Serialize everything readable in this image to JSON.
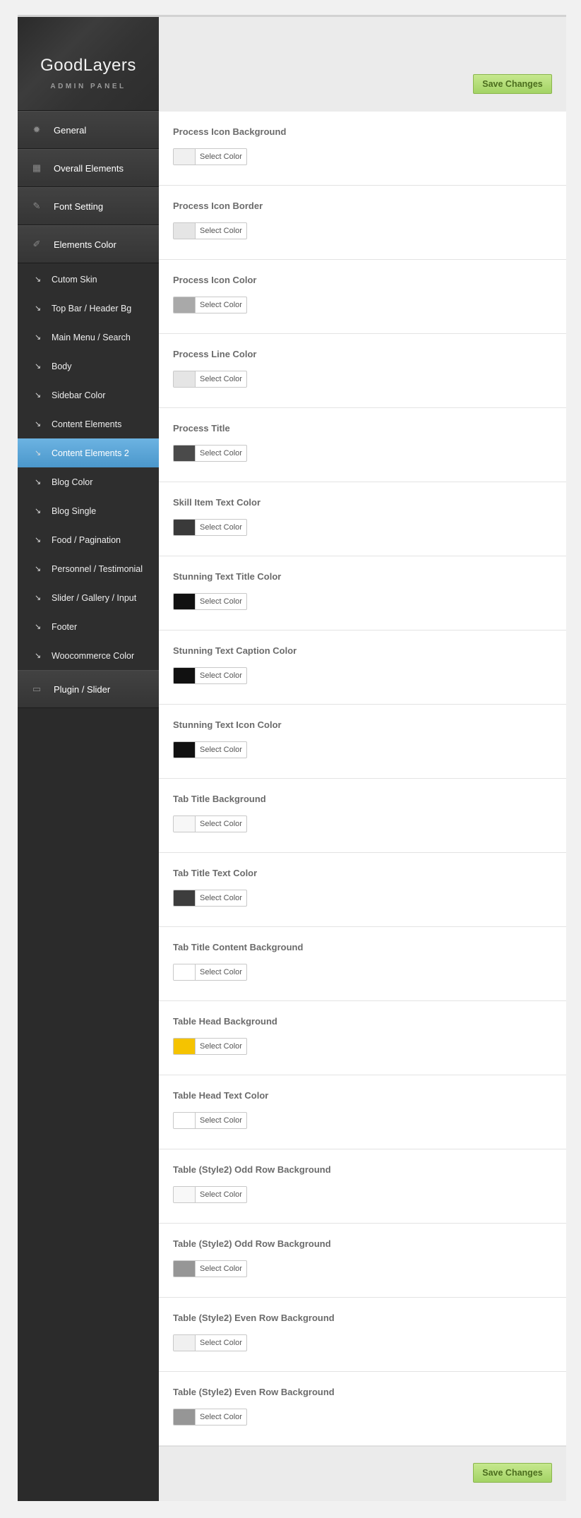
{
  "logo": {
    "title": "GoodLayers",
    "subtitle": "ADMIN PANEL"
  },
  "nav": {
    "top_items": [
      {
        "label": "General",
        "icon": "gear-icon"
      },
      {
        "label": "Overall Elements",
        "icon": "layout-icon"
      },
      {
        "label": "Font Setting",
        "icon": "pencil-icon"
      },
      {
        "label": "Elements Color",
        "icon": "brush-icon"
      }
    ],
    "sub_items": [
      {
        "label": "Cutom Skin"
      },
      {
        "label": "Top Bar / Header Bg"
      },
      {
        "label": "Main Menu / Search"
      },
      {
        "label": "Body"
      },
      {
        "label": "Sidebar Color"
      },
      {
        "label": "Content Elements"
      },
      {
        "label": "Content Elements 2",
        "active": true
      },
      {
        "label": "Blog Color"
      },
      {
        "label": "Blog Single"
      },
      {
        "label": "Food / Pagination"
      },
      {
        "label": "Personnel / Testimonial"
      },
      {
        "label": "Slider / Gallery / Input"
      },
      {
        "label": "Footer"
      },
      {
        "label": "Woocommerce Color"
      }
    ],
    "bottom_item": {
      "label": "Plugin / Slider",
      "icon": "monitor-icon"
    }
  },
  "actions": {
    "save_top": "Save Changes",
    "save_bottom": "Save Changes"
  },
  "picker_label": "Select Color",
  "settings": [
    {
      "label": "Process Icon Background",
      "color": "#f0f0f0"
    },
    {
      "label": "Process Icon Border",
      "color": "#e5e5e5"
    },
    {
      "label": "Process Icon Color",
      "color": "#a9a9a9"
    },
    {
      "label": "Process Line Color",
      "color": "#e5e5e5"
    },
    {
      "label": "Process Title",
      "color": "#4a4a4a"
    },
    {
      "label": "Skill Item Text Color",
      "color": "#3a3a3a"
    },
    {
      "label": "Stunning Text Title Color",
      "color": "#111111"
    },
    {
      "label": "Stunning Text Caption Color",
      "color": "#111111"
    },
    {
      "label": "Stunning Text Icon Color",
      "color": "#111111"
    },
    {
      "label": "Tab Title Background",
      "color": "#f7f7f7"
    },
    {
      "label": "Tab Title Text Color",
      "color": "#3d3d3d"
    },
    {
      "label": "Tab Title Content Background",
      "color": "#ffffff"
    },
    {
      "label": "Table Head Background",
      "color": "#f5c300"
    },
    {
      "label": "Table Head Text Color",
      "color": "#ffffff"
    },
    {
      "label": "Table (Style2) Odd Row Background",
      "color": "#f8f8f8"
    },
    {
      "label": "Table (Style2) Odd Row Background",
      "color": "#969696"
    },
    {
      "label": "Table (Style2) Even Row Background",
      "color": "#f0f0f0"
    },
    {
      "label": "Table (Style2) Even Row Background",
      "color": "#969696"
    }
  ]
}
